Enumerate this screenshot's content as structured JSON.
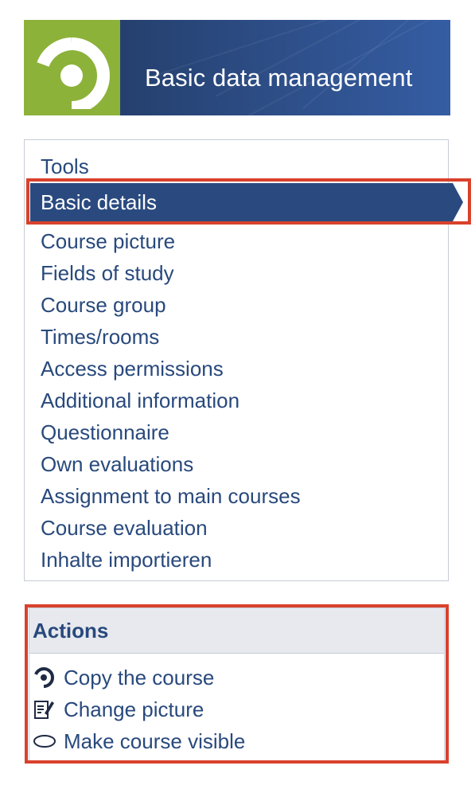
{
  "header": {
    "title": "Basic data management",
    "logo_icon": "studip-logo-icon",
    "colors": {
      "logo_bg": "#8cb23a",
      "banner": "#2d4d86"
    }
  },
  "nav": {
    "items": [
      {
        "label": "Tools",
        "active": false
      },
      {
        "label": "Basic details",
        "active": true
      },
      {
        "label": "Course picture",
        "active": false
      },
      {
        "label": "Fields of study",
        "active": false
      },
      {
        "label": "Course group",
        "active": false
      },
      {
        "label": "Times/rooms",
        "active": false
      },
      {
        "label": "Access permissions",
        "active": false
      },
      {
        "label": "Additional information",
        "active": false
      },
      {
        "label": "Questionnaire",
        "active": false
      },
      {
        "label": "Own evaluations",
        "active": false
      },
      {
        "label": "Assignment to main courses",
        "active": false
      },
      {
        "label": "Course evaluation",
        "active": false
      },
      {
        "label": "Inhalte importieren",
        "active": false
      }
    ],
    "active_color": "#2a4a7f",
    "text_color": "#28497c"
  },
  "actions": {
    "title": "Actions",
    "items": [
      {
        "label": "Copy the course",
        "icon": "copy-course-icon"
      },
      {
        "label": "Change picture",
        "icon": "edit-picture-icon"
      },
      {
        "label": "Make course visible",
        "icon": "visibility-eye-icon"
      }
    ]
  },
  "annotations": {
    "highlight_color": "#d9412c"
  }
}
